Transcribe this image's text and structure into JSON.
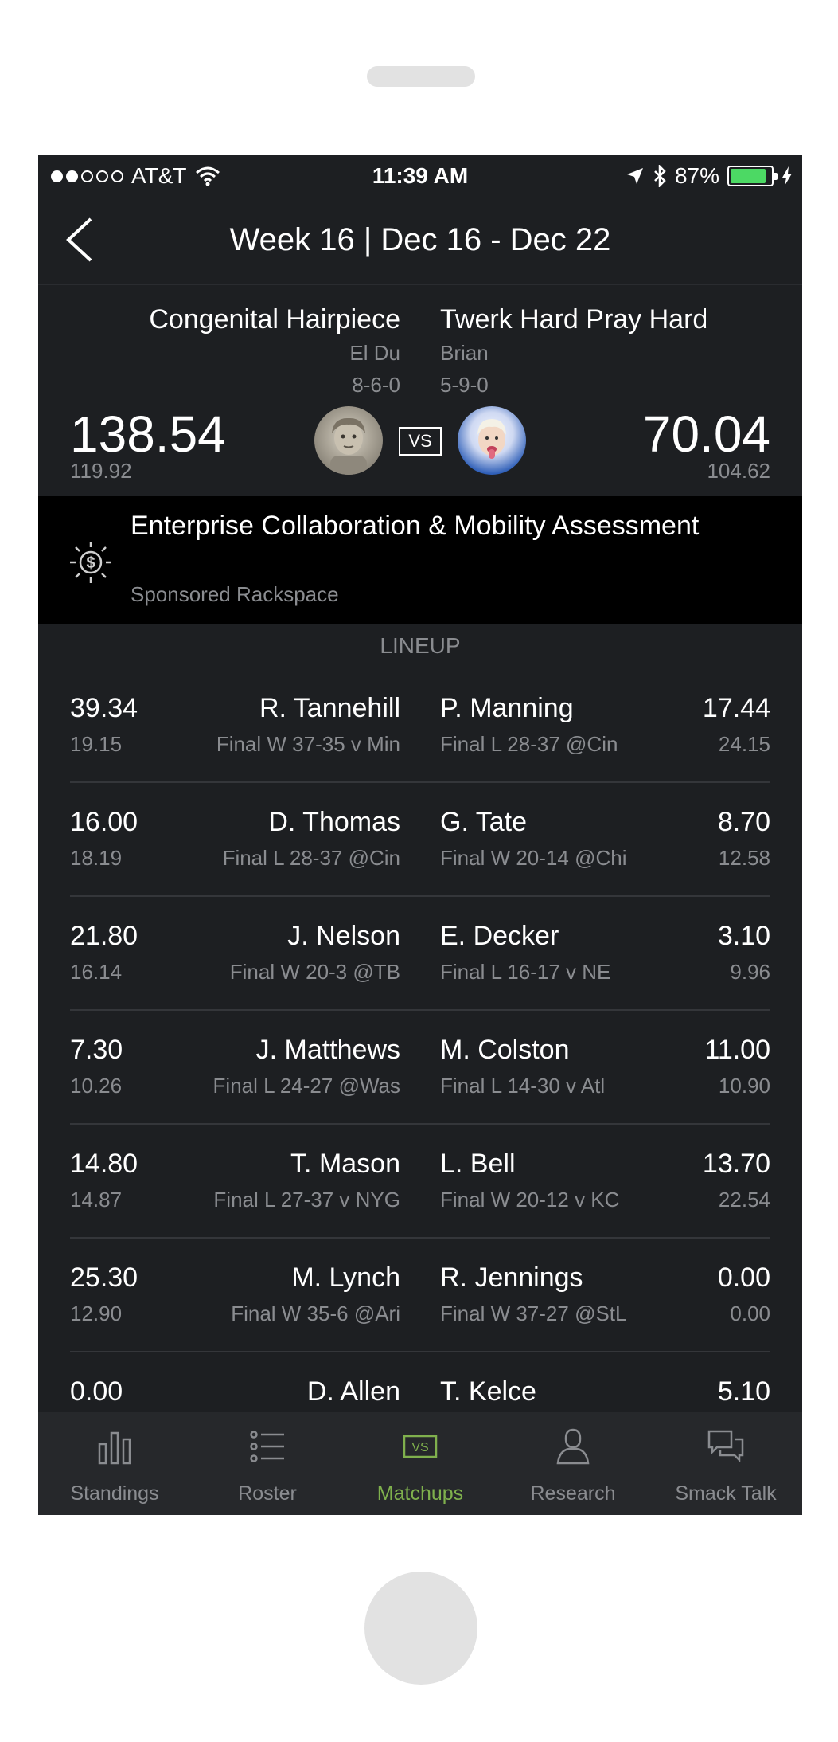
{
  "status_bar": {
    "carrier": "AT&T",
    "time": "11:39 AM",
    "battery": "87%",
    "signal_dots": [
      true,
      true,
      false,
      false,
      false
    ],
    "battery_color": "#4cd964"
  },
  "nav": {
    "title": "Week 16 | Dec 16 - Dec 22",
    "back_icon": "chevron-left-icon"
  },
  "matchup": {
    "left": {
      "team": "Congenital Hairpiece",
      "owner": "El Du",
      "record": "8-6-0",
      "score": "138.54",
      "projected": "119.92"
    },
    "right": {
      "team": "Twerk Hard Pray Hard",
      "owner": "Brian",
      "record": "5-9-0",
      "score": "70.04",
      "projected": "104.62"
    },
    "vs_label": "VS"
  },
  "sponsored": {
    "title": "Enterprise Collaboration & Mobility Assessment",
    "sponsor": "Sponsored Rackspace",
    "icon": "dollar-burst-icon"
  },
  "lineup": {
    "header": "LINEUP",
    "rows": [
      {
        "l_pts": "39.34",
        "l_proj": "19.15",
        "l_name": "R. Tannehill",
        "l_result": "Final W 37-35 v Min",
        "r_name": "P. Manning",
        "r_result": "Final L 28-37 @Cin",
        "r_pts": "17.44",
        "r_proj": "24.15"
      },
      {
        "l_pts": "16.00",
        "l_proj": "18.19",
        "l_name": "D. Thomas",
        "l_result": "Final L 28-37 @Cin",
        "r_name": "G. Tate",
        "r_result": "Final W 20-14 @Chi",
        "r_pts": "8.70",
        "r_proj": "12.58"
      },
      {
        "l_pts": "21.80",
        "l_proj": "16.14",
        "l_name": "J. Nelson",
        "l_result": "Final W 20-3 @TB",
        "r_name": "E. Decker",
        "r_result": "Final L 16-17 v NE",
        "r_pts": "3.10",
        "r_proj": "9.96"
      },
      {
        "l_pts": "7.30",
        "l_proj": "10.26",
        "l_name": "J. Matthews",
        "l_result": "Final L 24-27 @Was",
        "r_name": "M. Colston",
        "r_result": "Final L 14-30 v Atl",
        "r_pts": "11.00",
        "r_proj": "10.90"
      },
      {
        "l_pts": "14.80",
        "l_proj": "14.87",
        "l_name": "T. Mason",
        "l_result": "Final L 27-37 v NYG",
        "r_name": "L. Bell",
        "r_result": "Final W 20-12 v KC",
        "r_pts": "13.70",
        "r_proj": "22.54"
      },
      {
        "l_pts": "25.30",
        "l_proj": "12.90",
        "l_name": "M. Lynch",
        "l_result": "Final W 35-6 @Ari",
        "r_name": "R. Jennings",
        "r_result": "Final W 37-27 @StL",
        "r_pts": "0.00",
        "r_proj": "0.00"
      },
      {
        "l_pts": "0.00",
        "l_proj": "",
        "l_name": "D. Allen",
        "l_result": "",
        "r_name": "T. Kelce",
        "r_result": "",
        "r_pts": "5.10",
        "r_proj": ""
      }
    ]
  },
  "tabs": [
    {
      "label": "Standings",
      "icon": "bar-chart-icon",
      "active": false
    },
    {
      "label": "Roster",
      "icon": "list-icon",
      "active": false
    },
    {
      "label": "Matchups",
      "icon": "vs-icon",
      "active": true
    },
    {
      "label": "Research",
      "icon": "person-icon",
      "active": false
    },
    {
      "label": "Smack Talk",
      "icon": "chat-bubbles-icon",
      "active": false
    }
  ],
  "colors": {
    "background": "#1d1f22",
    "accent": "#7fb04d",
    "muted_text": "#8a8c90"
  }
}
